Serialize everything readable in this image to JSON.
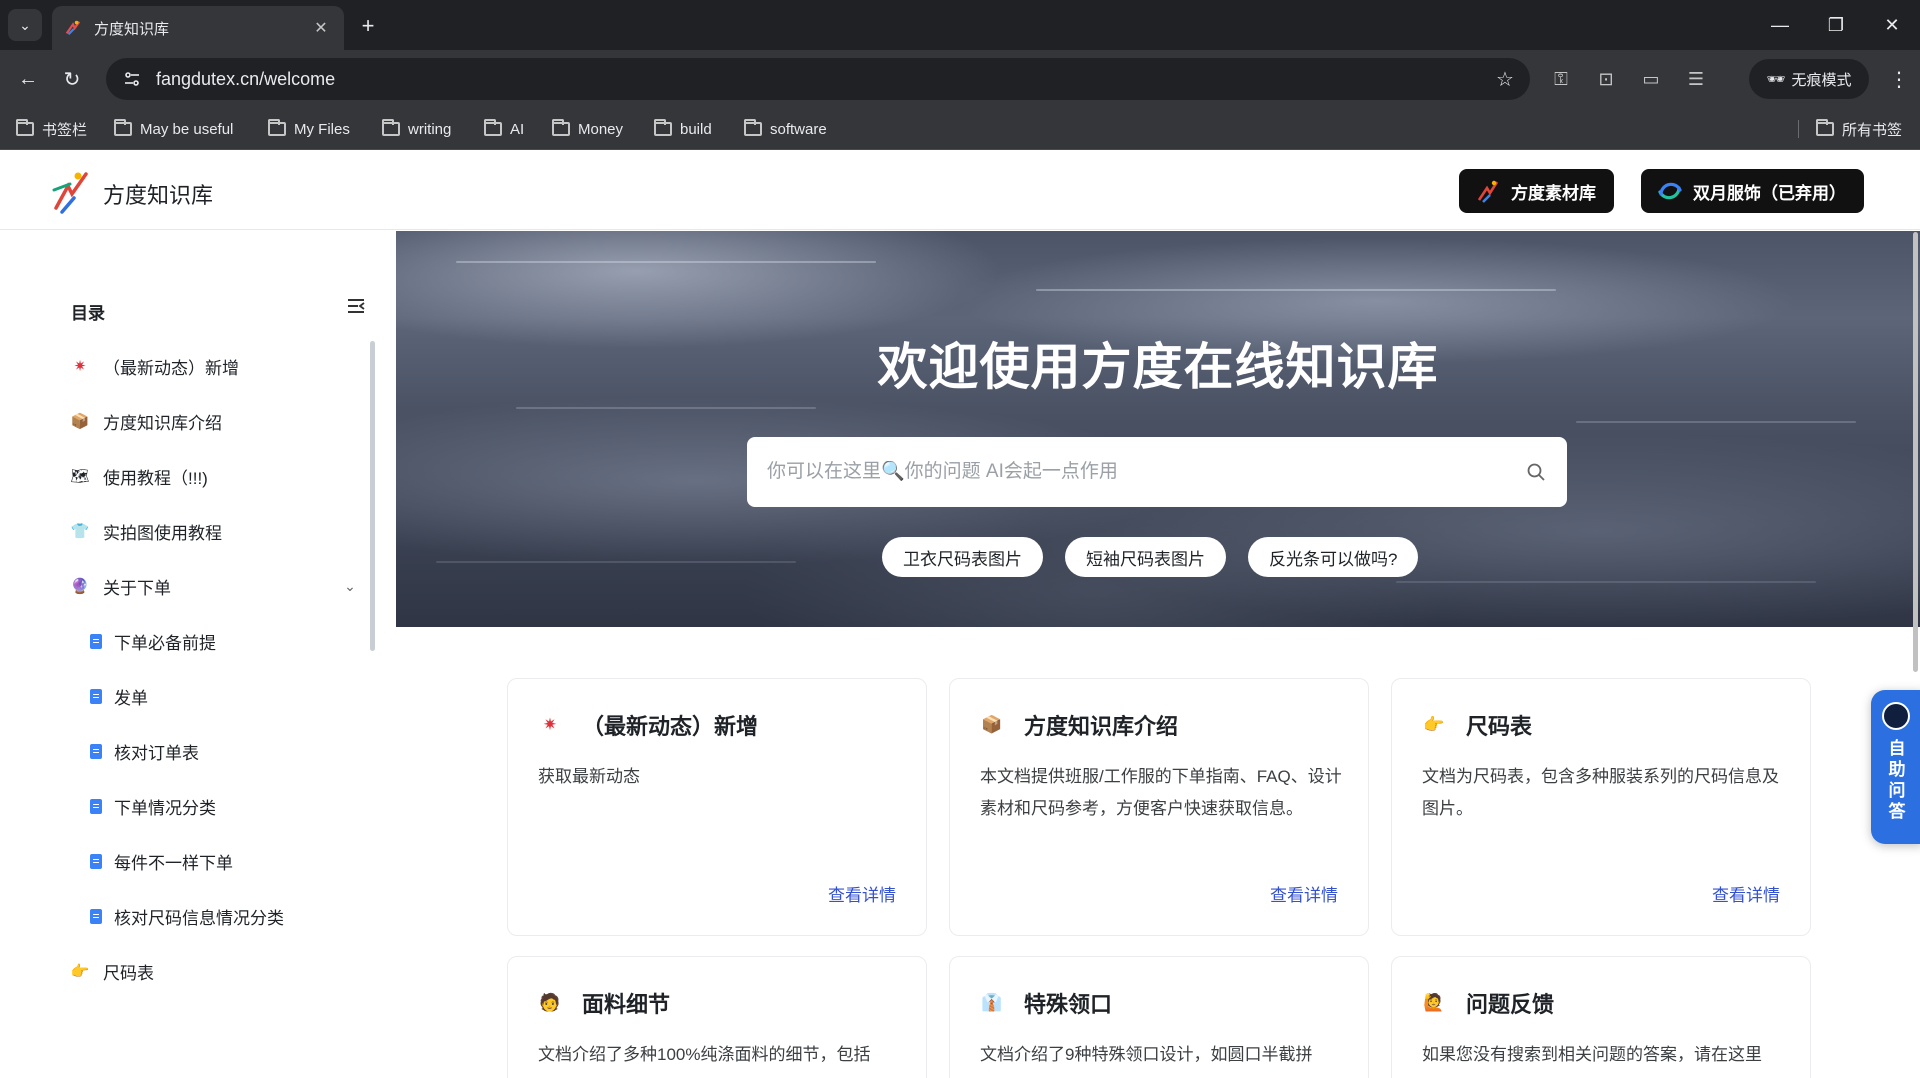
{
  "browser": {
    "tab_title": "方度知识库",
    "url": "fangdutex.cn/welcome",
    "incognito_label": "无痕模式",
    "bookmarks": [
      "书签栏",
      "May be useful",
      "My Files",
      "writing",
      "AI",
      "Money",
      "build",
      "software"
    ],
    "all_bookmarks": "所有书签"
  },
  "header": {
    "site_title": "方度知识库",
    "buttons": [
      "方度素材库",
      "双月服饰（已弃用）"
    ]
  },
  "sidebar": {
    "title": "目录",
    "items": [
      {
        "label": "（最新动态）新增",
        "icon": "sparkle-icon"
      },
      {
        "label": "方度知识库介绍",
        "icon": "package-icon"
      },
      {
        "label": "使用教程（!!!)",
        "icon": "map-icon"
      },
      {
        "label": "实拍图使用教程",
        "icon": "shirt-icon"
      },
      {
        "label": "关于下单",
        "icon": "sphere-icon"
      }
    ],
    "sub_items": [
      "下单必备前提",
      "发单",
      "核对订单表",
      "下单情况分类",
      "每件不一样下单",
      "核对尺码信息情况分类"
    ],
    "last_item": {
      "label": "尺码表",
      "icon": "pointing-hand-icon"
    }
  },
  "hero": {
    "title": "欢迎使用方度在线知识库",
    "search_placeholder": "你可以在这里🔍你的问题 AI会起一点作用",
    "chips": [
      "卫衣尺码表图片",
      "短袖尺码表图片",
      "反光条可以做吗?"
    ]
  },
  "cards": [
    {
      "icon": "✷",
      "title": "（最新动态）新增",
      "desc": "获取最新动态",
      "link": "查看详情"
    },
    {
      "icon": "📦",
      "title": "方度知识库介绍",
      "desc": "本文档提供班服/工作服的下单指南、FAQ、设计素材和尺码参考，方便客户快速获取信息。",
      "link": "查看详情"
    },
    {
      "icon": "👉",
      "title": "尺码表",
      "desc": "文档为尺码表，包含多种服装系列的尺码信息及图片。",
      "link": "查看详情"
    },
    {
      "icon": "🧑",
      "title": "面料细节",
      "desc": "文档介绍了多种100%纯涤面料的细节，包括",
      "link": ""
    },
    {
      "icon": "👔",
      "title": "特殊领口",
      "desc": "文档介绍了9种特殊领口设计，如圆口半截拼",
      "link": ""
    },
    {
      "icon": "🙋",
      "title": "问题反馈",
      "desc": "如果您没有搜索到相关问题的答案，请在这里",
      "link": ""
    }
  ],
  "help": {
    "label": "自助问答"
  },
  "colors": {
    "accent": "#3451d1",
    "help_blue": "#2b6fe0",
    "header_button": "#111111"
  }
}
